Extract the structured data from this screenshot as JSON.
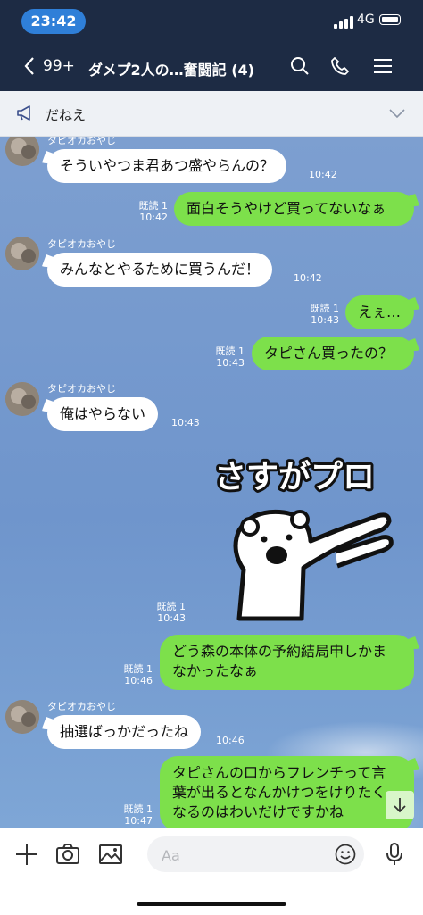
{
  "status": {
    "time": "23:42",
    "network": "4G"
  },
  "header": {
    "back_count": "99+",
    "title": "ダメプ2人の…奮闘記 (4)"
  },
  "notice": {
    "text": "だねえ"
  },
  "messages": [
    {
      "sender": "タピオカおやじ",
      "text": "そういやつま君あつ盛やらんの？",
      "time": "10:42"
    },
    {
      "read": "既読 1",
      "time": "10:42",
      "text": "面白そうやけど買ってないなぁ"
    },
    {
      "sender": "タピオカおやじ",
      "text": "みんなとやるために買うんだ！",
      "time": "10:42"
    },
    {
      "read": "既読 1",
      "time": "10:43",
      "text": "えぇ…"
    },
    {
      "read": "既読 1",
      "time": "10:43",
      "text": "タピさん買ったの？"
    },
    {
      "sender": "タピオカおやじ",
      "text": "俺はやらない",
      "time": "10:43"
    },
    {
      "read": "既読 1",
      "time": "10:43",
      "sticker_text": "さすがプロ"
    },
    {
      "read": "既読 1",
      "time": "10:46",
      "line1": "どう森の本体の予約結局申しかま",
      "line2": "なかったなぁ"
    },
    {
      "sender": "タピオカおやじ",
      "text": "抽選ばっかだったね",
      "time": "10:46"
    },
    {
      "read": "既読 1",
      "time": "10:47",
      "line1": "タピさんの口からフレンチって言",
      "line2": "葉が出るとなんかけつをけりたく",
      "line3": "なるのはわいだけですかね"
    }
  ],
  "composer": {
    "placeholder": "Aa"
  },
  "colors": {
    "header": "#1d2b44",
    "time_pill": "#2f7fd8",
    "outgoing_bubble": "#7de04b",
    "chat_bg": "#7399ce"
  },
  "icons": [
    "back-chevron-icon",
    "search-icon",
    "phone-icon",
    "menu-icon",
    "megaphone-icon",
    "chevron-down-icon",
    "plus-icon",
    "camera-icon",
    "image-icon",
    "emoji-icon",
    "microphone-icon",
    "scroll-down-icon"
  ]
}
